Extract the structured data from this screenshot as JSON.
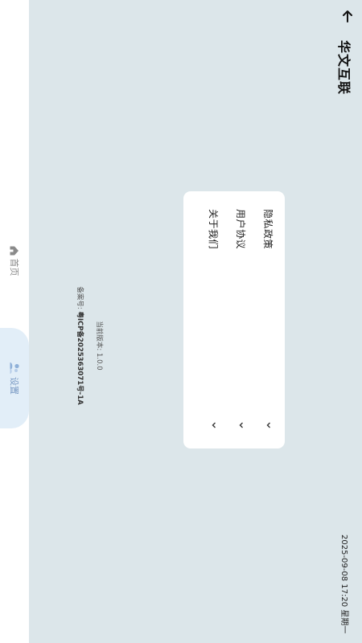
{
  "header": {
    "back_icon": "arrow-left-icon",
    "title": "华文互联",
    "datetime": "2025-09-08 17:20 星期一"
  },
  "menu": {
    "items": [
      {
        "label": "隐私政策",
        "icon": "chevron-down-icon"
      },
      {
        "label": "用户协议",
        "icon": "chevron-down-icon"
      },
      {
        "label": "关于我们",
        "icon": "chevron-down-icon"
      }
    ]
  },
  "footer": {
    "version_label": "当前版本:",
    "version_value": "1.0.0",
    "icp_label": "备案号:",
    "icp_value": "粤ICP备2025363071号-1A"
  },
  "nav": {
    "home_label": "首页",
    "home_icon": "home-icon",
    "settings_label": "设置",
    "settings_icon": "users-icon"
  },
  "colors": {
    "background": "#dce6ea",
    "card": "#ffffff",
    "nav_active_bg": "#e2eef8",
    "nav_active_text": "#7a9ac4",
    "nav_inactive_text": "#888888"
  }
}
